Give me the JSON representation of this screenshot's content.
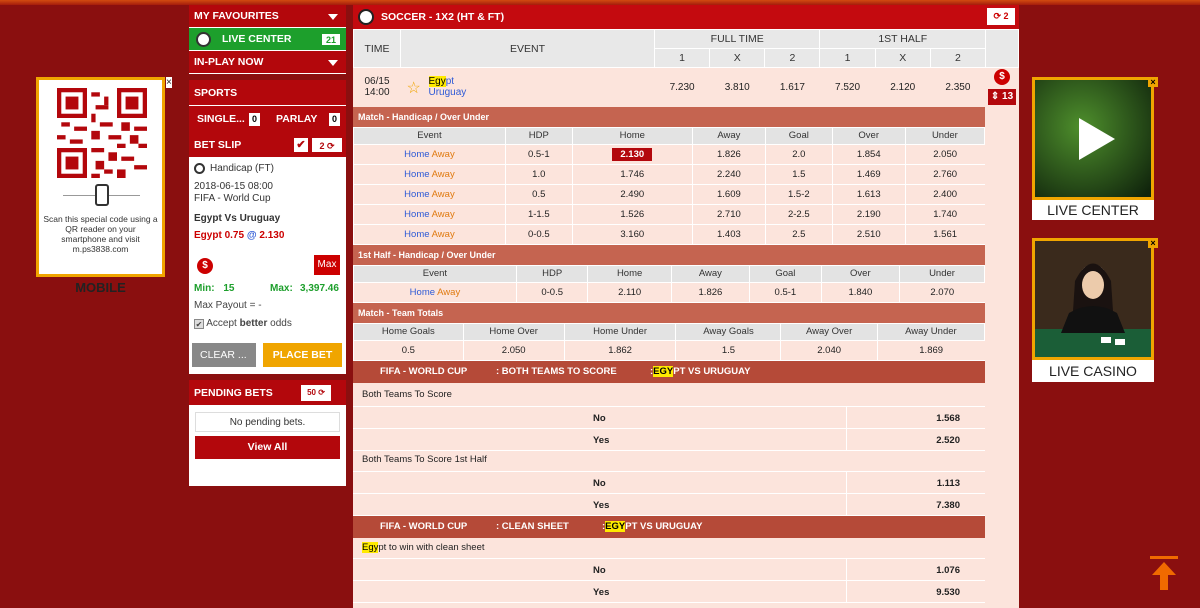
{
  "left_promo": {
    "qr_text": "Scan this special code using a QR reader on your smartphone and visit m.ps3838.com",
    "label": "MOBILE",
    "close": "×"
  },
  "right_promos": [
    {
      "label": "LIVE CENTER",
      "close": "×"
    },
    {
      "label": "LIVE CASINO",
      "close": "×"
    }
  ],
  "menu": {
    "favourites": "MY FAVOURITES",
    "live_center": "LIVE CENTER",
    "live_count": "21",
    "in_play": "IN-PLAY NOW",
    "sports": "SPORTS",
    "single": "SINGLE...",
    "single_count": "0",
    "parlay": "PARLAY",
    "parlay_count": "0",
    "bet_slip": "BET SLIP",
    "bet_slip_count": "2"
  },
  "betslip": {
    "type": "Handicap (FT)",
    "datetime": "2018-06-15 08:00",
    "league": "FIFA - World Cup",
    "match": "Egypt Vs Uruguay",
    "selection_team": "Egypt",
    "selection_line": "0.75",
    "selection_at": "@",
    "selection_odds": "2.130",
    "max_label": "Max",
    "min_label": "Min:",
    "min_value": "15",
    "max_text": "Max:",
    "max_value": "3,397.46",
    "max_payout": "Max Payout =  -",
    "accept_pre": "Accept ",
    "accept_bold": "better",
    "accept_post": " odds",
    "clear": "CLEAR ...",
    "place": "PLACE BET"
  },
  "pending": {
    "title": "PENDING BETS",
    "count": "50",
    "empty": "No pending bets.",
    "view_all": "View All"
  },
  "main": {
    "title": "SOCCER - 1X2 (HT & FT)",
    "refresh_count": "2",
    "headers": {
      "time": "TIME",
      "event": "EVENT",
      "full_time": "FULL TIME",
      "first_half": "1ST HALF",
      "c1": "1",
      "cx": "X",
      "c2": "2"
    },
    "match": {
      "date": "06/15",
      "time": "14:00",
      "home_hl": "Egy",
      "home_rest": "pt",
      "away": "Uruguay",
      "ft": [
        "7.230",
        "3.810",
        "1.617"
      ],
      "ht": [
        "7.520",
        "2.120",
        "2.350"
      ],
      "more": "13"
    }
  },
  "hdp_ou": {
    "title": "Match - Handicap / Over Under",
    "cols": [
      "Event",
      "HDP",
      "Home",
      "Away",
      "Goal",
      "Over",
      "Under"
    ],
    "home": "Home",
    "away": "Away",
    "rows": [
      {
        "hdp": "0.5-1",
        "home": "2.130",
        "away": "1.826",
        "goal": "2.0",
        "over": "1.854",
        "under": "2.050"
      },
      {
        "hdp": "1.0",
        "home": "1.746",
        "away": "2.240",
        "goal": "1.5",
        "over": "1.469",
        "under": "2.760"
      },
      {
        "hdp": "0.5",
        "home": "2.490",
        "away": "1.609",
        "goal": "1.5-2",
        "over": "1.613",
        "under": "2.400"
      },
      {
        "hdp": "1-1.5",
        "home": "1.526",
        "away": "2.710",
        "goal": "2-2.5",
        "over": "2.190",
        "under": "1.740"
      },
      {
        "hdp": "0-0.5",
        "home": "3.160",
        "away": "1.403",
        "goal": "2.5",
        "over": "2.510",
        "under": "1.561"
      }
    ]
  },
  "first_half": {
    "title": "1st Half - Handicap / Over Under",
    "row": {
      "hdp": "0-0.5",
      "home": "2.110",
      "away": "1.826",
      "goal": "0.5-1",
      "over": "1.840",
      "under": "2.070"
    }
  },
  "team_totals": {
    "title": "Match - Team Totals",
    "cols": [
      "Home Goals",
      "Home Over",
      "Home Under",
      "Away Goals",
      "Away Over",
      "Away Under"
    ],
    "row": [
      "0.5",
      "2.050",
      "1.862",
      "1.5",
      "2.040",
      "1.869"
    ]
  },
  "btts": {
    "league": "FIFA - WORLD CUP",
    "market": ": BOTH TEAMS TO SCORE",
    "colon": ":",
    "egy": "EGY",
    "rest": "PT VS URUGUAY",
    "prop1": "Both Teams To Score",
    "no": "No",
    "yes": "Yes",
    "p1_no": "1.568",
    "p1_yes": "2.520",
    "prop2": "Both Teams To Score 1st Half",
    "p2_no": "1.113",
    "p2_yes": "7.380"
  },
  "clean_sheet": {
    "league": "FIFA - WORLD CUP",
    "market": ": CLEAN SHEET",
    "colon": ":",
    "egy": "EGY",
    "rest": "PT VS URUGUAY",
    "prop_hl": "Egy",
    "prop_rest": "pt to win with clean sheet",
    "no": "No",
    "yes": "Yes",
    "p_no": "1.076",
    "p_yes": "9.530"
  }
}
